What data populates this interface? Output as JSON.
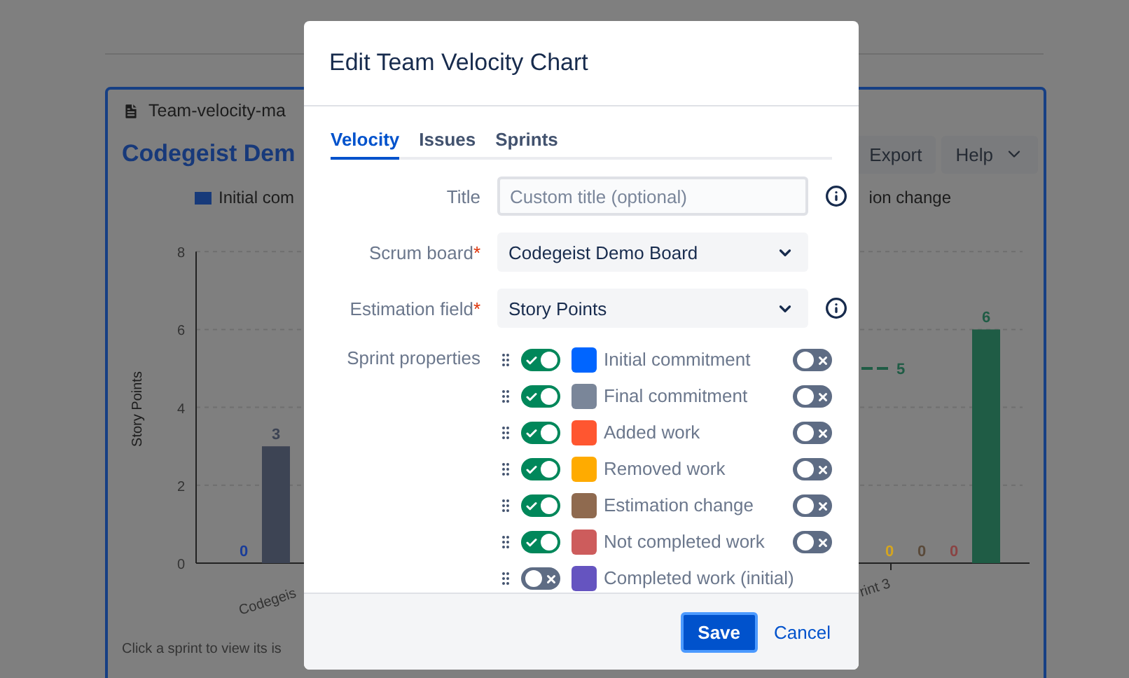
{
  "page": {
    "card_title": "Team-velocity-ma",
    "heading": "Codegeist Dem",
    "buttons": [
      "Export",
      "Help"
    ],
    "legend": [
      {
        "label": "Initial com",
        "color": "#173a7a"
      },
      {
        "label": "ion change"
      }
    ],
    "footer_text": "Click a sprint to view its is",
    "target_line_label": "5",
    "chart_data": {
      "type": "bar",
      "ylabel": "Story Points",
      "categories": [
        "Codegeis",
        "rint 3"
      ],
      "ylim": [
        0,
        8
      ],
      "yticks": [
        0,
        2,
        4,
        6,
        8
      ],
      "grid": true,
      "series": [
        {
          "color": "#1a3d99",
          "values": [
            0,
            null
          ]
        },
        {
          "color": "#3d4454",
          "values": [
            3,
            null
          ]
        },
        {
          "color": "#d4a520",
          "values": [
            null,
            0
          ]
        },
        {
          "color": "#5a4a3a",
          "values": [
            null,
            0
          ]
        },
        {
          "color": "#8a4444",
          "values": [
            null,
            0
          ]
        },
        {
          "color": "#1f5c45",
          "values": [
            null,
            6
          ]
        }
      ],
      "value_labels": [
        [
          "0",
          null
        ],
        [
          "3",
          null
        ],
        [
          null,
          "0"
        ],
        [
          null,
          "0"
        ],
        [
          null,
          "0"
        ],
        [
          null,
          "6"
        ]
      ]
    }
  },
  "dialog": {
    "title": "Edit Team Velocity Chart",
    "tabs": [
      {
        "label": "Velocity",
        "selected": true
      },
      {
        "label": "Issues",
        "selected": false
      },
      {
        "label": "Sprints",
        "selected": false
      }
    ],
    "fields": [
      {
        "kind": "input",
        "label": "Title",
        "placeholder": "Custom title (optional)",
        "info": true
      },
      {
        "kind": "select",
        "label": "Scrum board",
        "required_mark": "*",
        "value": "Codegeist Demo Board",
        "info": false
      },
      {
        "kind": "select",
        "label": "Estimation field",
        "required_mark": "*",
        "value": "Story Points",
        "info": true
      }
    ],
    "properties_label": "Sprint properties",
    "properties": [
      {
        "label": "Initial commitment",
        "color": "#0065ff",
        "on": true,
        "secondary_on": false
      },
      {
        "label": "Final commitment",
        "color": "#7a8699",
        "on": true,
        "secondary_on": false
      },
      {
        "label": "Added work",
        "color": "#ff5630",
        "on": true,
        "secondary_on": false
      },
      {
        "label": "Removed work",
        "color": "#ffab00",
        "on": true,
        "secondary_on": false
      },
      {
        "label": "Estimation change",
        "color": "#8f6a4f",
        "on": true,
        "secondary_on": false
      },
      {
        "label": "Not completed work",
        "color": "#cd5c5c",
        "on": true,
        "secondary_on": false
      },
      {
        "label": "Completed work (initial)",
        "color": "#6554c0",
        "on": false
      }
    ],
    "save": "Save",
    "cancel": "Cancel"
  }
}
